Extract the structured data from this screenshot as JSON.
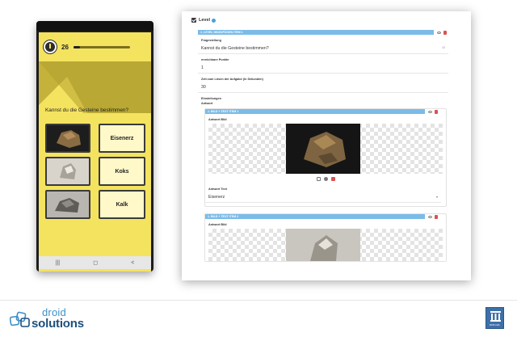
{
  "phone": {
    "timer_count": "26",
    "timer_progress": 0.12,
    "question": "Kannst du die Gesteine bestimmen?",
    "answers": [
      {
        "label": "Eisenerz",
        "image": "dark-rock"
      },
      {
        "label": "Koks",
        "image": "light-rock"
      },
      {
        "label": "Kalk",
        "image": "gray-rock"
      }
    ],
    "nav": {
      "recent": "|||",
      "home": "◻",
      "back": "<"
    },
    "colors": {
      "background": "#f4e35f",
      "shadow": "#c9b832",
      "answer_fill": "#fff8c9"
    }
  },
  "cms": {
    "level_label": "Level",
    "item_bar": "1. LEVEL HINZUFÜGEN ITEM 1",
    "fields": {
      "question_label": "Fragestellung",
      "question_value": "Kannst du die Gesteine bestimmen?",
      "question_count": "33",
      "points_label": "erreichbare Punkte",
      "points_value": "1",
      "time_label": "Zeit zum Lösen der Aufgabe (in Sekunden)",
      "time_value": "30",
      "settings_label": "Einstellungen",
      "answer_label": "Antwort"
    },
    "answer_items": [
      {
        "bar": "1. BILD + TEXT ITEM 1",
        "image_label": "Antwort Bild",
        "text_label": "Antwort Text",
        "text_value": "Eisenerz"
      },
      {
        "bar": "1. BILD + TEXT ITEM 2",
        "image_label": "Antwort Bild"
      }
    ],
    "colors": {
      "bar": "#7bbbe8",
      "delete": "#d9534f"
    }
  },
  "footer": {
    "brand_top": "droid",
    "brand_bottom": "solutions",
    "partner_label": "RUB-LWL",
    "colors": {
      "brand_light": "#3e8fc9",
      "brand_dark": "#1e4f7e",
      "partner": "#3d6fa8"
    }
  }
}
